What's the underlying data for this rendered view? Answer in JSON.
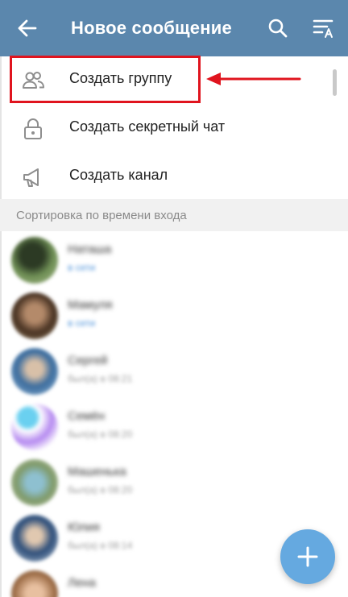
{
  "appbar": {
    "title": "Новое сообщение",
    "back_icon": "arrow-left-icon",
    "search_icon": "search-icon",
    "sort_icon": "sort-alpha-icon",
    "background": "#5b87ad"
  },
  "menu": {
    "items": [
      {
        "label": "Создать группу",
        "icon": "group-icon",
        "highlighted": true
      },
      {
        "label": "Создать секретный чат",
        "icon": "lock-icon",
        "highlighted": false
      },
      {
        "label": "Создать канал",
        "icon": "megaphone-icon",
        "highlighted": false
      }
    ]
  },
  "annotation": {
    "color": "#e0141e",
    "arrow_icon": "arrow-left-annotation-icon"
  },
  "section": {
    "title": "Сортировка по времени входа"
  },
  "contacts": [
    {
      "name": "Наташа",
      "status": "в сети",
      "online": true,
      "avatar_color": "#4b6b3a"
    },
    {
      "name": "Мамуля",
      "status": "в сети",
      "online": true,
      "avatar_color": "#7a5a3a"
    },
    {
      "name": "Сергей",
      "status": "был(а) в 08:21",
      "online": false,
      "avatar_color": "#4f7fa8"
    },
    {
      "name": "Семён",
      "status": "был(а) в 08:20",
      "online": false,
      "avatar_color": "#9a6ee0"
    },
    {
      "name": "Машенька",
      "status": "был(а) в 08:20",
      "online": false,
      "avatar_color": "#7f9a6a"
    },
    {
      "name": "Юлия",
      "status": "был(а) в 08:14",
      "online": false,
      "avatar_color": "#3d5f8a"
    },
    {
      "name": "Лена",
      "status": "",
      "online": false,
      "avatar_color": "#a0704a"
    }
  ],
  "fab": {
    "icon": "plus-icon",
    "color": "#65a9e0"
  }
}
